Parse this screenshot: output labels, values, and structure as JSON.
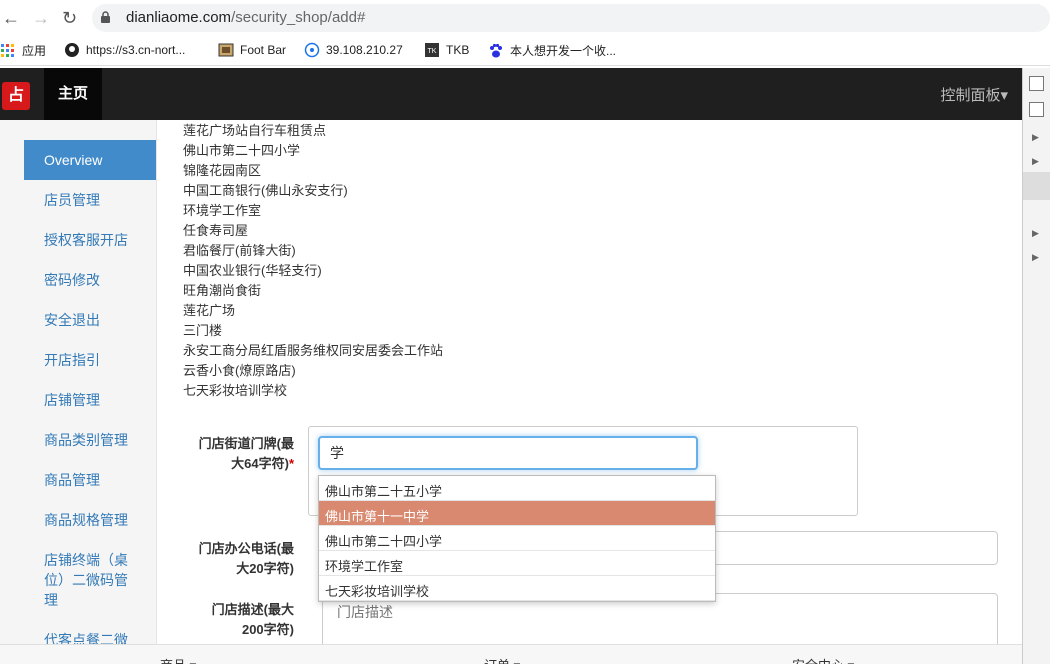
{
  "browser": {
    "url_host": "dianliaome.com",
    "url_path": "/security_shop/add#",
    "bookmarks": [
      {
        "label": "应用",
        "icon": "apps-grid-icon"
      },
      {
        "label": "https://s3.cn-nort...",
        "icon": "github-icon"
      },
      {
        "label": "Foot Bar",
        "icon": "foot-bar-icon"
      },
      {
        "label": "39.108.210.27",
        "icon": "target-icon"
      },
      {
        "label": "TKB",
        "icon": "tkb-icon"
      },
      {
        "label": "本人想开发一个收...",
        "icon": "baidu-paw-icon"
      }
    ]
  },
  "navbar": {
    "logo_text": "占",
    "home_label": "主页",
    "control_panel_label": "控制面板▾"
  },
  "sidebar": {
    "items": [
      {
        "label": "Overview"
      },
      {
        "label": "店员管理"
      },
      {
        "label": "授权客服开店"
      },
      {
        "label": "密码修改"
      },
      {
        "label": "安全退出"
      },
      {
        "label": "开店指引"
      },
      {
        "label": "店铺管理"
      },
      {
        "label": "商品类别管理"
      },
      {
        "label": "商品管理"
      },
      {
        "label": "商品规格管理"
      },
      {
        "label": "店铺终端（桌\n位）二微码管\n理"
      },
      {
        "label": "代客点餐二微"
      }
    ]
  },
  "address_list": [
    "莲花广场站自行车租赁点",
    "佛山市第二十四小学",
    "锦隆花园南区",
    "中国工商银行(佛山永安支行)",
    "环境学工作室",
    "任食寿司屋",
    "君临餐厅(前锋大街)",
    "中国农业银行(华轻支行)",
    "旺角潮尚食街",
    "莲花广场",
    "三门楼",
    "永安工商分局红盾服务维权同安居委会工作站",
    "云香小食(燎原路店)",
    "七天彩妆培训学校"
  ],
  "form": {
    "street_label_1": "门店街道门牌(最",
    "street_label_2": "大64字符)",
    "street_required": "*",
    "street_value": "学",
    "phone_label_1": "门店办公电话(最",
    "phone_label_2": "大20字符)",
    "desc_label_1": "门店描述(最大",
    "desc_label_2": "200字符)",
    "desc_placeholder": "门店描述"
  },
  "suggestions": [
    {
      "label": "佛山市第二十五小学",
      "highlighted": false
    },
    {
      "label": "佛山市第十一中学",
      "highlighted": true
    },
    {
      "label": "佛山市第二十四小学",
      "highlighted": false
    },
    {
      "label": "环境学工作室",
      "highlighted": false
    },
    {
      "label": "七天彩妆培训学校",
      "highlighted": false
    }
  ],
  "footer": {
    "items": [
      "商品 ▾",
      "订单 ▾",
      "安全中心 ▾"
    ]
  },
  "colors": {
    "accent": "#428bca",
    "link": "#337ab7",
    "highlight": "#d9896f",
    "navbar": "#1f1f1f",
    "logo": "#d7191c"
  }
}
